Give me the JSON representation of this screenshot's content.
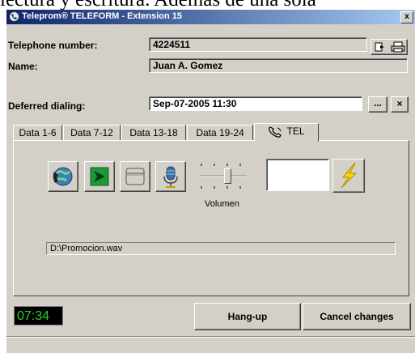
{
  "background_text": "lectura y escritura. Además de una sola",
  "window": {
    "title": "Teleprom® TELEFORM - Extension 15",
    "close_label": "x"
  },
  "form": {
    "telephone_label": "Telephone number:",
    "telephone_value": "4224511",
    "name_label": "Name:",
    "name_value": "Juan A. Gomez",
    "deferred_label": "Deferred dialing:",
    "deferred_value": "Sep-07-2005 11:30",
    "browse_label": "...",
    "clear_label": "×"
  },
  "tabs": [
    {
      "label": "Data 1-6"
    },
    {
      "label": "Data 7-12"
    },
    {
      "label": "Data 13-18"
    },
    {
      "label": "Data 19-24"
    },
    {
      "label": "TEL",
      "active": true
    }
  ],
  "tel": {
    "volume_label": "Volumen",
    "volume_level": 0.6,
    "file_path": "D:\\Promocion.wav",
    "number_value": ""
  },
  "footer": {
    "clock": "07:34",
    "hangup_label": "Hang-up",
    "cancel_label": "Cancel changes"
  },
  "colors": {
    "titlebar_start": "#0a246a",
    "titlebar_end": "#a6caf0",
    "window_face": "#d4d0c8",
    "clock_text": "#2bd12b"
  }
}
